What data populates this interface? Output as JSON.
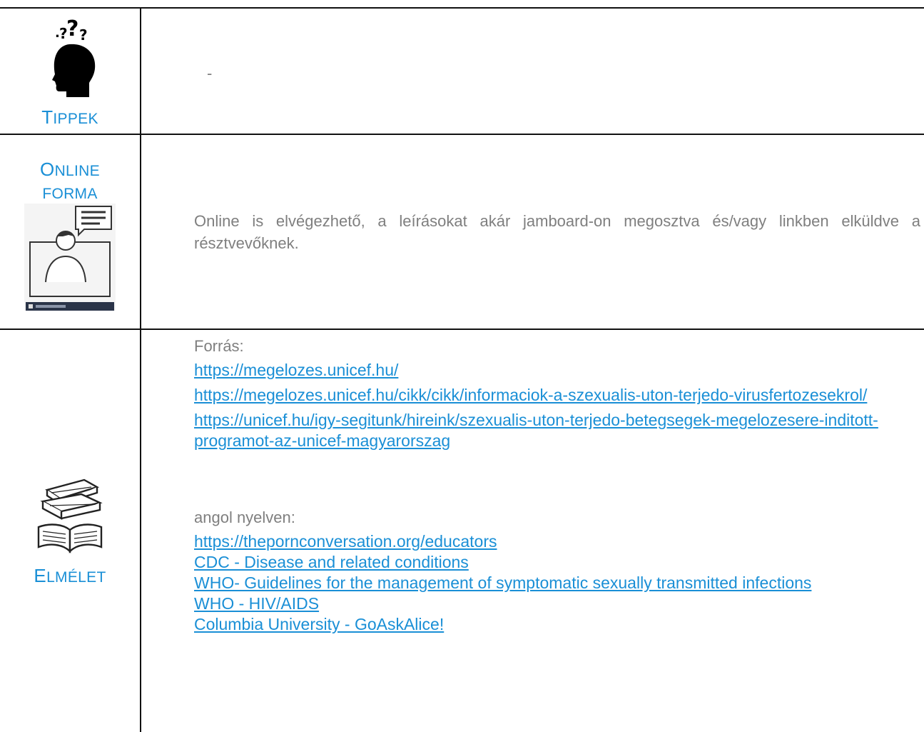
{
  "rows": {
    "tippek": {
      "label_first": "T",
      "label_rest": "IPPEK",
      "content": "-"
    },
    "online": {
      "label_line1_first": "O",
      "label_line1_rest": "NLINE",
      "label_line2": "FORMA",
      "content": "Online is elvégezhető, a leírásokat akár jamboard-on megosztva és/vagy linkben elküldve a résztvevőknek."
    },
    "elmelet": {
      "label_first": "E",
      "label_rest": "LMÉLET",
      "source_heading": "Forrás:",
      "links_hu": [
        "https://megelozes.unicef.hu/",
        "https://megelozes.unicef.hu/cikk/cikk/informaciok-a-szexualis-uton-terjedo-virusfertozesekrol/",
        "https://unicef.hu/igy-segitunk/hireink/szexualis-uton-terjedo-betegsegek-megelozesere-inditott-programot-az-unicef-magyarorszag"
      ],
      "english_heading": "angol nyelven:",
      "links_en": [
        "https://thepornconversation.org/educators ",
        "CDC - Disease and related conditions",
        "WHO- Guidelines for the management of symptomatic sexually transmitted infections",
        "WHO - HIV/AIDS",
        "Columbia University - GoAskAlice!"
      ]
    }
  }
}
